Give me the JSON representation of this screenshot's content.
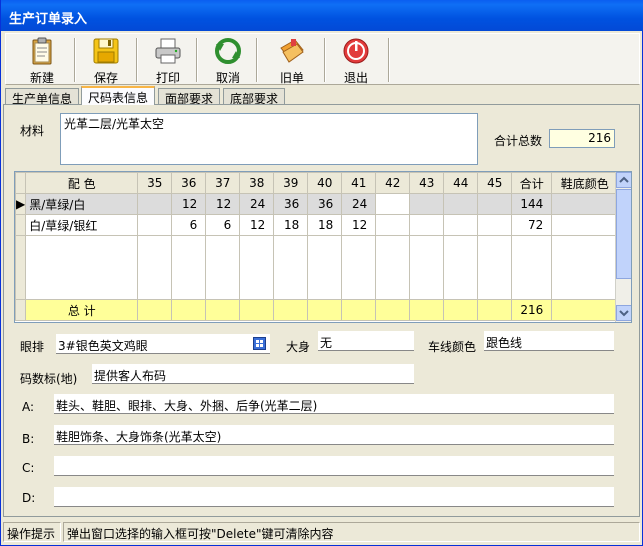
{
  "window": {
    "title": "生产订单录入"
  },
  "toolbar": {
    "buttons": [
      {
        "label": "新建",
        "icon": "clipboard-new-icon"
      },
      {
        "label": "保存",
        "icon": "floppy-save-icon"
      },
      {
        "label": "打印",
        "icon": "printer-icon"
      },
      {
        "label": "取消",
        "icon": "undo-arrows-icon"
      },
      {
        "label": "旧单",
        "icon": "folder-old-order-icon"
      },
      {
        "label": "退出",
        "icon": "power-exit-icon"
      }
    ]
  },
  "tabs": [
    {
      "label": "生产单信息",
      "active": false
    },
    {
      "label": "尺码表信息",
      "active": true
    },
    {
      "label": "面部要求",
      "active": false
    },
    {
      "label": "底部要求",
      "active": false
    }
  ],
  "form": {
    "material_label": "材料",
    "material_value": "光革二层/光革太空",
    "total_label": "合计总数",
    "total_value": "216"
  },
  "grid": {
    "headers": [
      "配  色",
      "35",
      "36",
      "37",
      "38",
      "39",
      "40",
      "41",
      "42",
      "43",
      "44",
      "45",
      "合计",
      "鞋底颜色"
    ],
    "rows": [
      {
        "color": "黑/草绿/白",
        "sizes": [
          "",
          "12",
          "12",
          "24",
          "36",
          "36",
          "24",
          "",
          "",
          "",
          ""
        ],
        "total": "144",
        "sole": ""
      },
      {
        "color": "白/草绿/银红",
        "sizes": [
          "",
          "6",
          "6",
          "12",
          "18",
          "18",
          "12",
          "",
          "",
          "",
          ""
        ],
        "total": "72",
        "sole": ""
      }
    ],
    "total_row": {
      "label": "总  计",
      "total": "216"
    }
  },
  "details": {
    "eyelet_label": "眼排",
    "eyelet_value": "3#银色英文鸡眼",
    "body_label": "大身",
    "body_value": "无",
    "thread_label": "车线颜色",
    "thread_value": "跟色线",
    "size_mark_label": "码数标(地)",
    "size_mark_value": "提供客人布码",
    "a_label": "A:",
    "a_value": "鞋头、鞋胆、眼排、大身、外捆、后争(光革二层)",
    "b_label": "B:",
    "b_value": "鞋胆饰条、大身饰条(光革太空)",
    "c_label": "C:",
    "c_value": "",
    "d_label": "D:",
    "d_value": ""
  },
  "status": {
    "label": "操作提示",
    "message": "弹出窗口选择的输入框可按\"Delete\"键可清除内容"
  },
  "colors": {
    "titlebar": "#0052e0",
    "total_row": "#ffff99",
    "selected_row": "#dcdcdc",
    "tab_active_accent": "#f8b546"
  }
}
